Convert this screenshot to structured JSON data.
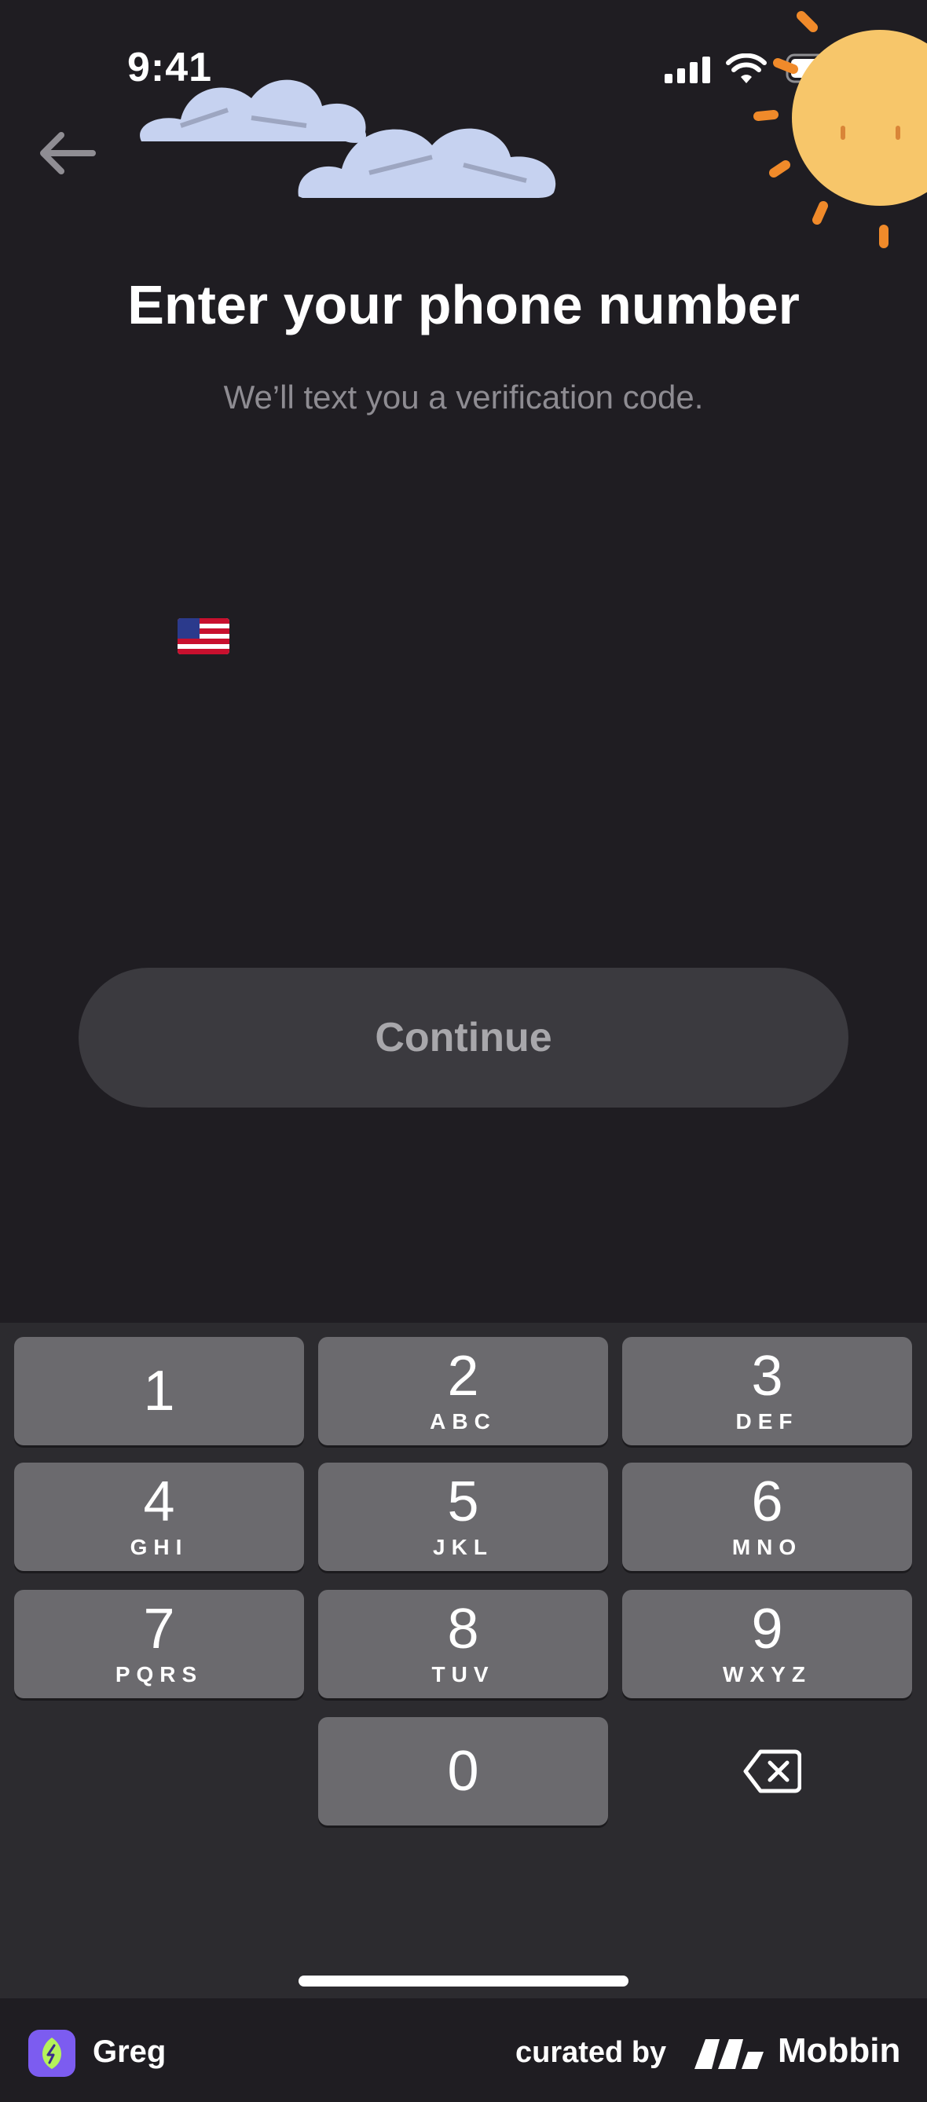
{
  "status_bar": {
    "time": "9:41",
    "icons": [
      "signal-icon",
      "wifi-icon",
      "battery-icon"
    ]
  },
  "nav": {
    "back_icon": "arrow-left-icon"
  },
  "illustration": {
    "items": [
      "clouds",
      "sun"
    ],
    "colors": {
      "cloud": "#c6d2f0",
      "sun": "#f7c66a",
      "rays": "#f08a2a"
    }
  },
  "header": {
    "title": "Enter your phone number",
    "subtitle": "We’ll text you a verification code."
  },
  "phone_input": {
    "country_flag": "us-flag-icon",
    "value": ""
  },
  "actions": {
    "continue_label": "Continue"
  },
  "keypad": {
    "keys": [
      {
        "num": "1",
        "letters": ""
      },
      {
        "num": "2",
        "letters": "ABC"
      },
      {
        "num": "3",
        "letters": "DEF"
      },
      {
        "num": "4",
        "letters": "GHI"
      },
      {
        "num": "5",
        "letters": "JKL"
      },
      {
        "num": "6",
        "letters": "MNO"
      },
      {
        "num": "7",
        "letters": "PQRS"
      },
      {
        "num": "8",
        "letters": "TUV"
      },
      {
        "num": "9",
        "letters": "WXYZ"
      },
      {
        "num": "0",
        "letters": ""
      }
    ],
    "delete_icon": "backspace-icon"
  },
  "footer": {
    "app_name": "Greg",
    "curated_by": "curated by",
    "brand": "Mobbin"
  },
  "colors": {
    "background": "#1f1d22",
    "button_bg": "#3b3a3f",
    "key_bg": "#6b6a6e",
    "keypad_bg": "#2c2b2f",
    "app_icon": "#7c5cf0"
  }
}
